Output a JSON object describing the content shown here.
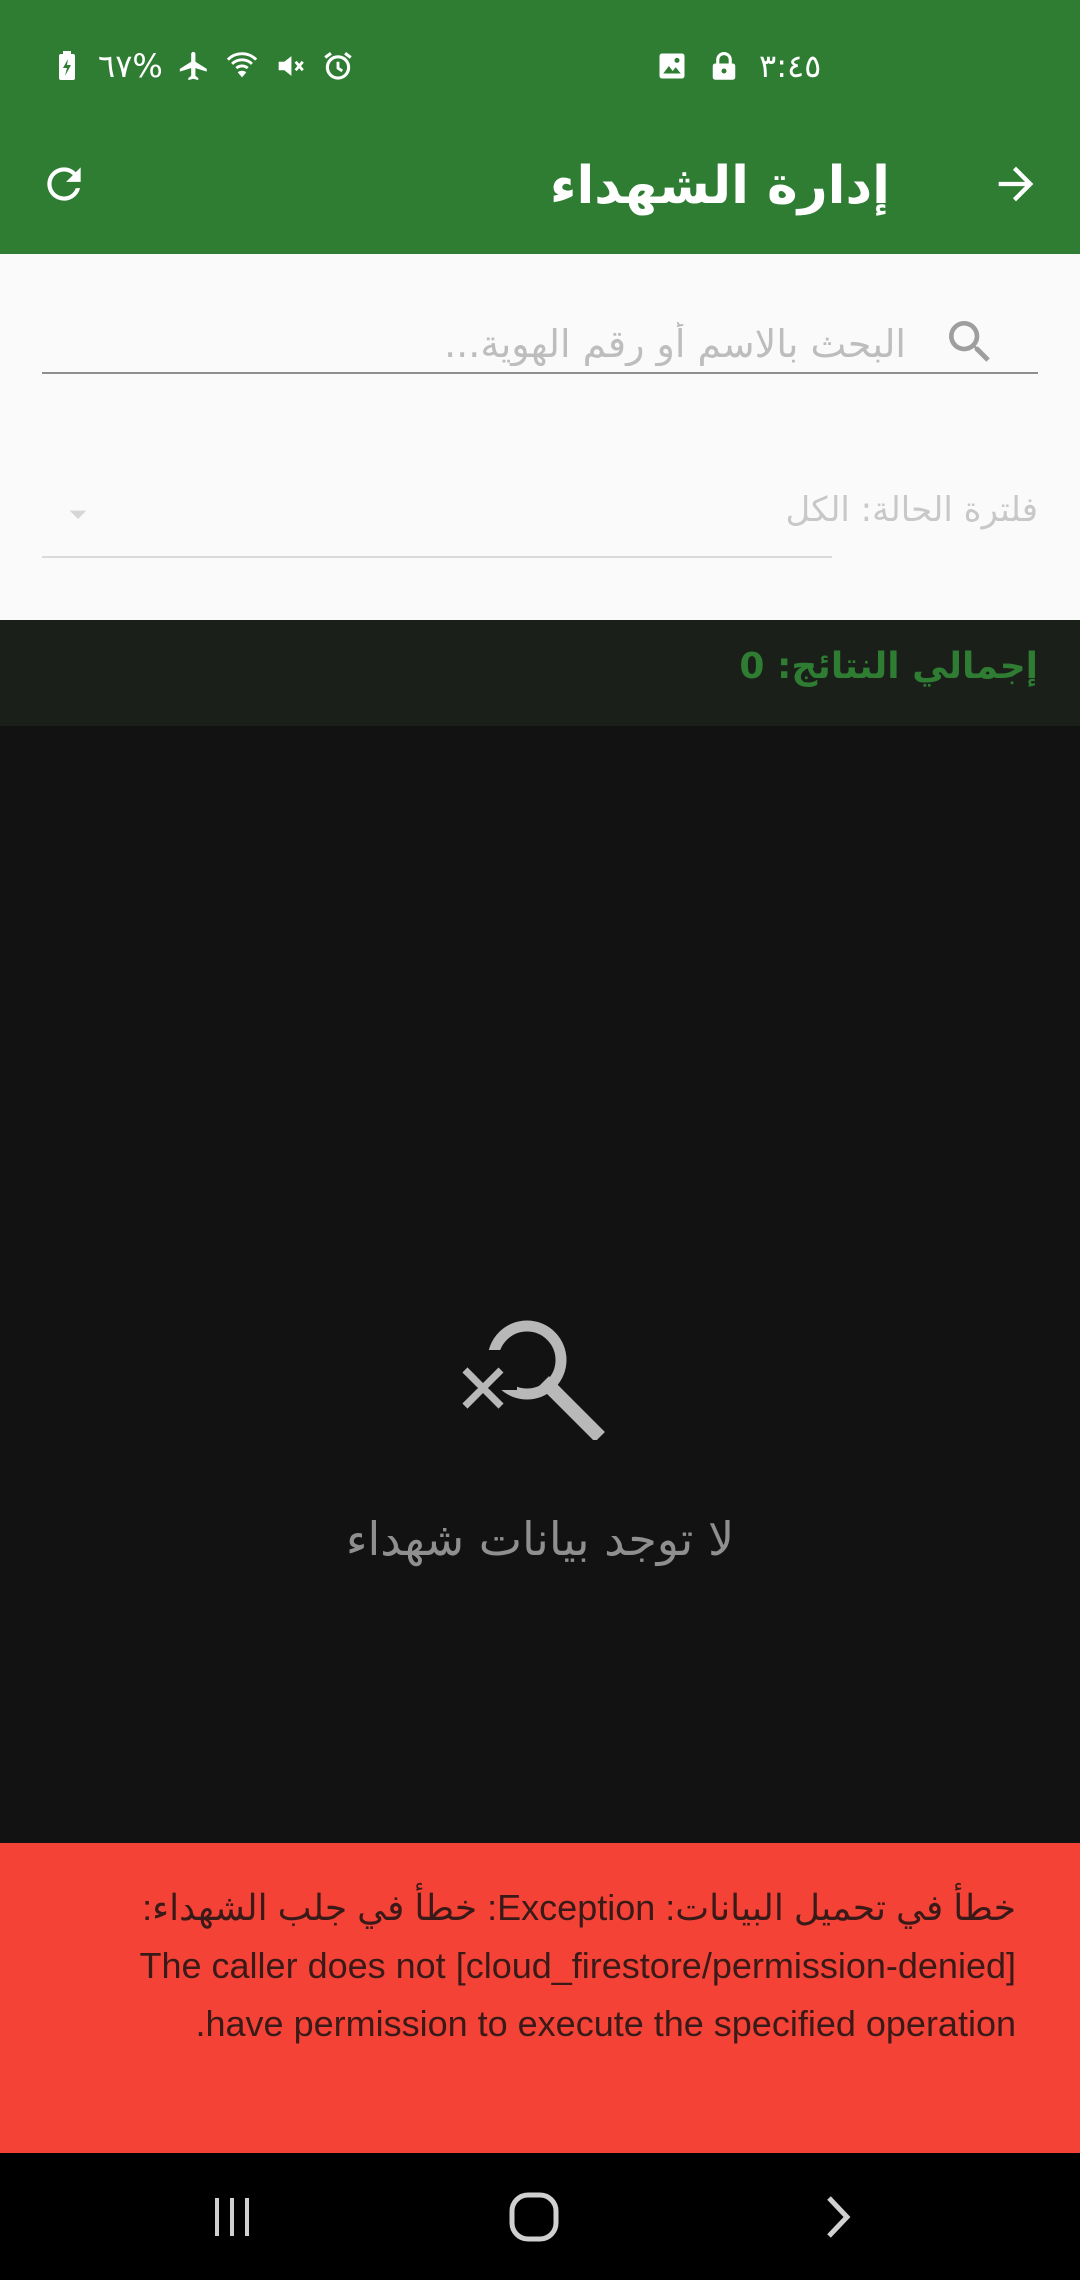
{
  "status_bar": {
    "battery": "٦٧%",
    "time": "٣:٤٥"
  },
  "app_bar": {
    "title": "إدارة الشهداء"
  },
  "search": {
    "placeholder": "البحث بالاسم أو رقم الهوية..."
  },
  "filter": {
    "label": "فلترة الحالة: الكل"
  },
  "results": {
    "total_label": "إجمالي النتائج: 0"
  },
  "empty_state": {
    "message": "لا توجد بيانات شهداء"
  },
  "error": {
    "message": "خطأ في تحميل البيانات: Exception: خطأ في جلب الشهداء: [cloud_firestore/permission-denied] The caller does not have permission to execute the specified operation."
  },
  "colors": {
    "primary": "#2e7d32",
    "error": "#f44336",
    "background": "#121212"
  },
  "icons": [
    "refresh-icon",
    "arrow-forward-icon",
    "search-icon",
    "dropdown-arrow-icon",
    "search-off-icon"
  ]
}
